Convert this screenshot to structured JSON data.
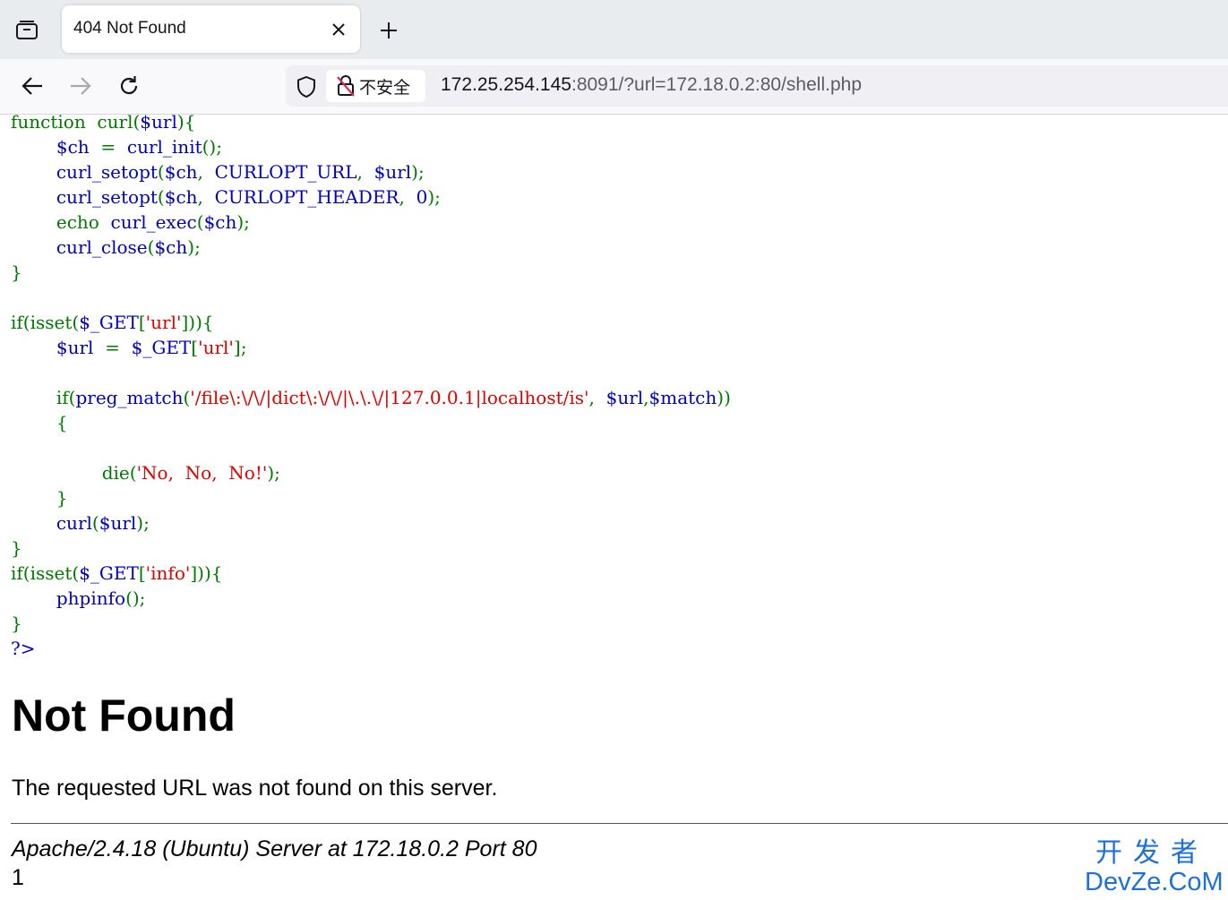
{
  "tab": {
    "title": "404 Not Found"
  },
  "urlbar": {
    "security_label": "不安全",
    "url_host": "172.25.254.145",
    "url_rest": ":8091/?url=172.18.0.2:80/shell.php"
  },
  "source_code": [
    [
      [
        "kw",
        "function  curl("
      ],
      [
        "df",
        "$url"
      ],
      [
        "kw",
        "){"
      ]
    ],
    [
      [
        "kw",
        "        "
      ],
      [
        "df",
        "$ch  "
      ],
      [
        "kw",
        "=  "
      ],
      [
        "df",
        "curl_init"
      ],
      [
        "kw",
        "();"
      ]
    ],
    [
      [
        "kw",
        "        "
      ],
      [
        "df",
        "curl_setopt"
      ],
      [
        "kw",
        "("
      ],
      [
        "df",
        "$ch"
      ],
      [
        "kw",
        ",  "
      ],
      [
        "df",
        "CURLOPT_URL"
      ],
      [
        "kw",
        ",  "
      ],
      [
        "df",
        "$url"
      ],
      [
        "kw",
        ");"
      ]
    ],
    [
      [
        "kw",
        "        "
      ],
      [
        "df",
        "curl_setopt"
      ],
      [
        "kw",
        "("
      ],
      [
        "df",
        "$ch"
      ],
      [
        "kw",
        ",  "
      ],
      [
        "df",
        "CURLOPT_HEADER"
      ],
      [
        "kw",
        ",  "
      ],
      [
        "df",
        "0"
      ],
      [
        "kw",
        ");"
      ]
    ],
    [
      [
        "kw",
        "        echo  "
      ],
      [
        "df",
        "curl_exec"
      ],
      [
        "kw",
        "("
      ],
      [
        "df",
        "$ch"
      ],
      [
        "kw",
        ");"
      ]
    ],
    [
      [
        "kw",
        "        "
      ],
      [
        "df",
        "curl_close"
      ],
      [
        "kw",
        "("
      ],
      [
        "df",
        "$ch"
      ],
      [
        "kw",
        ");"
      ]
    ],
    [
      [
        "kw",
        "}"
      ]
    ],
    [
      [
        "kw",
        ""
      ]
    ],
    [
      [
        "kw",
        "if(isset("
      ],
      [
        "df",
        "$_GET"
      ],
      [
        "kw",
        "["
      ],
      [
        "st",
        "'url'"
      ],
      [
        "kw",
        "])){"
      ]
    ],
    [
      [
        "kw",
        "        "
      ],
      [
        "df",
        "$url  "
      ],
      [
        "kw",
        "=  "
      ],
      [
        "df",
        "$_GET"
      ],
      [
        "kw",
        "["
      ],
      [
        "st",
        "'url'"
      ],
      [
        "kw",
        "];"
      ]
    ],
    [
      [
        "kw",
        ""
      ]
    ],
    [
      [
        "kw",
        "        if("
      ],
      [
        "df",
        "preg_match"
      ],
      [
        "kw",
        "("
      ],
      [
        "st",
        "'/file\\:\\/\\/|dict\\:\\/\\/|\\.\\.\\/|127.0.0.1|localhost/is'"
      ],
      [
        "kw",
        ",  "
      ],
      [
        "df",
        "$url"
      ],
      [
        "kw",
        ","
      ],
      [
        "df",
        "$match"
      ],
      [
        "kw",
        "))"
      ]
    ],
    [
      [
        "kw",
        "        {"
      ]
    ],
    [
      [
        "kw",
        ""
      ]
    ],
    [
      [
        "kw",
        "                die("
      ],
      [
        "st",
        "'No,  No,  No!'"
      ],
      [
        "kw",
        ");"
      ]
    ],
    [
      [
        "kw",
        "        }"
      ]
    ],
    [
      [
        "kw",
        "        "
      ],
      [
        "df",
        "curl"
      ],
      [
        "kw",
        "("
      ],
      [
        "df",
        "$url"
      ],
      [
        "kw",
        ");"
      ]
    ],
    [
      [
        "kw",
        "}"
      ]
    ],
    [
      [
        "kw",
        "if(isset("
      ],
      [
        "df",
        "$_GET"
      ],
      [
        "kw",
        "["
      ],
      [
        "st",
        "'info'"
      ],
      [
        "kw",
        "])){"
      ]
    ],
    [
      [
        "kw",
        "        "
      ],
      [
        "df",
        "phpinfo"
      ],
      [
        "kw",
        "();"
      ]
    ],
    [
      [
        "kw",
        "}"
      ]
    ],
    [
      [
        "df",
        "?>"
      ]
    ]
  ],
  "error_page": {
    "heading": "Not Found",
    "message": "The requested URL was not found on this server.",
    "address": "Apache/2.4.18 (Ubuntu) Server at 172.18.0.2 Port 80",
    "extra": "1"
  },
  "watermark": {
    "cn": "开发者",
    "en": "DevZe.CoM"
  },
  "colors": {
    "keyword": "#007700",
    "default": "#0000bb",
    "string": "#dd0000",
    "watermark": "#1e6fd9"
  },
  "icons": [
    "tab-manager-icon",
    "close-icon",
    "plus-icon",
    "back-arrow-icon",
    "forward-arrow-icon",
    "reload-icon",
    "shield-icon",
    "insecure-lock-icon"
  ]
}
